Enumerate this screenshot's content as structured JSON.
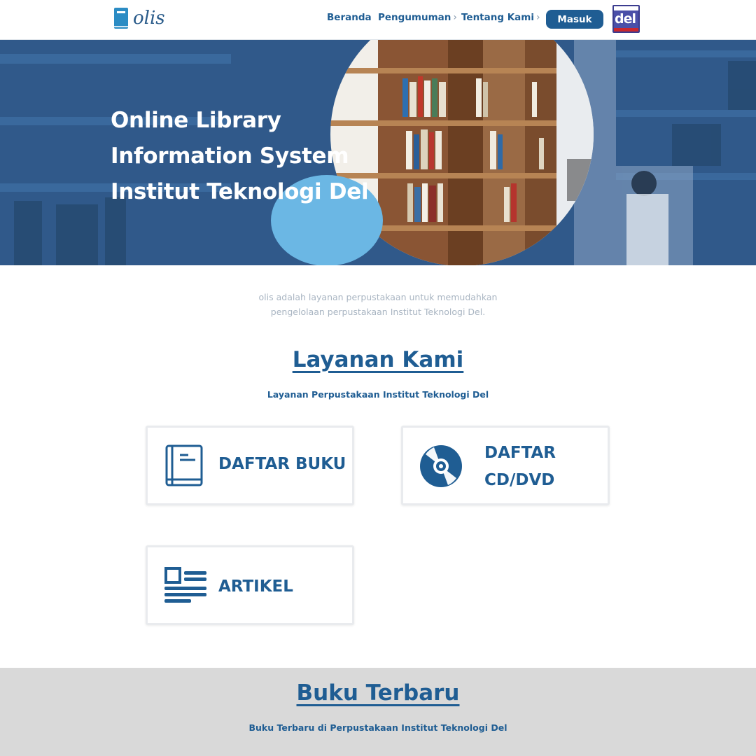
{
  "header": {
    "logo_text": "olis",
    "nav": {
      "beranda": "Beranda",
      "pengumuman": "Pengumuman",
      "tentang": "Tentang Kami"
    },
    "login_label": "Masuk",
    "partner_logo_text": "del"
  },
  "hero": {
    "line1": "Online Library",
    "line2": "Information System",
    "line3": "Institut Teknologi Del"
  },
  "intro": {
    "line1": "olis adalah layanan perpustakaan  untuk memudahkan",
    "line2": "pengelolaan perpustakaan Institut Teknologi Del."
  },
  "layanan": {
    "title": "Layanan Kami",
    "subtitle": "Layanan Perpustakaan Institut Teknologi Del",
    "cards": [
      {
        "label": "DAFTAR BUKU",
        "icon": "book-icon"
      },
      {
        "label_line1": "DAFTAR",
        "label_line2": "CD/DVD",
        "icon": "disc-icon"
      },
      {
        "label": "ARTIKEL",
        "icon": "article-icon"
      }
    ]
  },
  "terbaru": {
    "title": "Buku Terbaru",
    "subtitle": "Buku Terbaru di Perpustakaan Institut Teknologi Del"
  },
  "colors": {
    "primary": "#1f5d93",
    "hero_overlay": "#2f5a8c",
    "accent_blob": "#6bb7e4",
    "band": "#d9d9d9"
  }
}
